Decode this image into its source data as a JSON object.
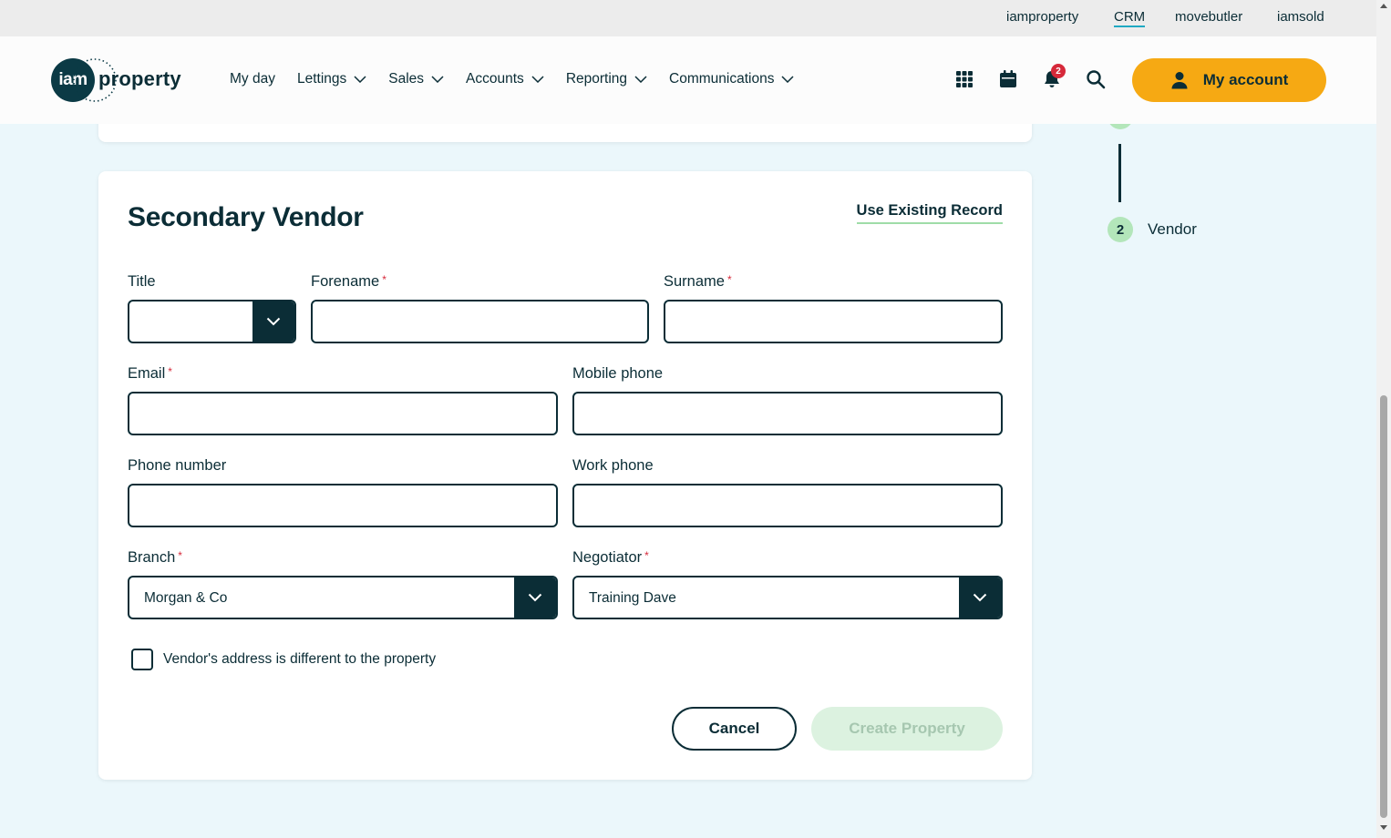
{
  "top_links": [
    {
      "label": "iamproperty",
      "active": false
    },
    {
      "label": "CRM",
      "active": true
    },
    {
      "label": "movebutler",
      "active": false
    },
    {
      "label": "iamsold",
      "active": false
    }
  ],
  "logo": {
    "mark": "iam",
    "text": "property"
  },
  "nav": [
    {
      "label": "My day",
      "dropdown": false
    },
    {
      "label": "Lettings",
      "dropdown": true
    },
    {
      "label": "Sales",
      "dropdown": true
    },
    {
      "label": "Accounts",
      "dropdown": true
    },
    {
      "label": "Reporting",
      "dropdown": true
    },
    {
      "label": "Communications",
      "dropdown": true
    }
  ],
  "toolbar": {
    "icons": [
      "apps-grid-icon",
      "calendar-icon",
      "bell-icon",
      "search-icon"
    ],
    "notification_count": "2",
    "account_label": "My account"
  },
  "form": {
    "title": "Secondary Vendor",
    "use_existing": "Use Existing Record",
    "fields": {
      "title": {
        "label": "Title",
        "value": ""
      },
      "forename": {
        "label": "Forename",
        "value": "",
        "placeholder": ""
      },
      "surname": {
        "label": "Surname",
        "value": "",
        "placeholder": ""
      },
      "email": {
        "label": "Email",
        "value": "",
        "placeholder": ""
      },
      "mobile": {
        "label": "Mobile phone",
        "value": "",
        "placeholder": ""
      },
      "phone": {
        "label": "Phone number",
        "value": "",
        "placeholder": ""
      },
      "work_phone": {
        "label": "Work phone",
        "value": "",
        "placeholder": ""
      },
      "branch": {
        "label": "Branch",
        "value": "Morgan & Co"
      },
      "negotiator": {
        "label": "Negotiator",
        "value": "Training Dave"
      }
    },
    "required_mark": "*",
    "checkbox_label": "Vendor's address is different to the property",
    "cancel_label": "Cancel",
    "create_label": "Create Property"
  },
  "stepper": {
    "step_number": "2",
    "step_label": "Vendor"
  },
  "colors": {
    "primary": "#0b2d36",
    "accent_orange": "#f6a913",
    "accent_green": "#b3e6ba",
    "required_red": "#d6293a",
    "page_bg": "#ebf7fb"
  }
}
